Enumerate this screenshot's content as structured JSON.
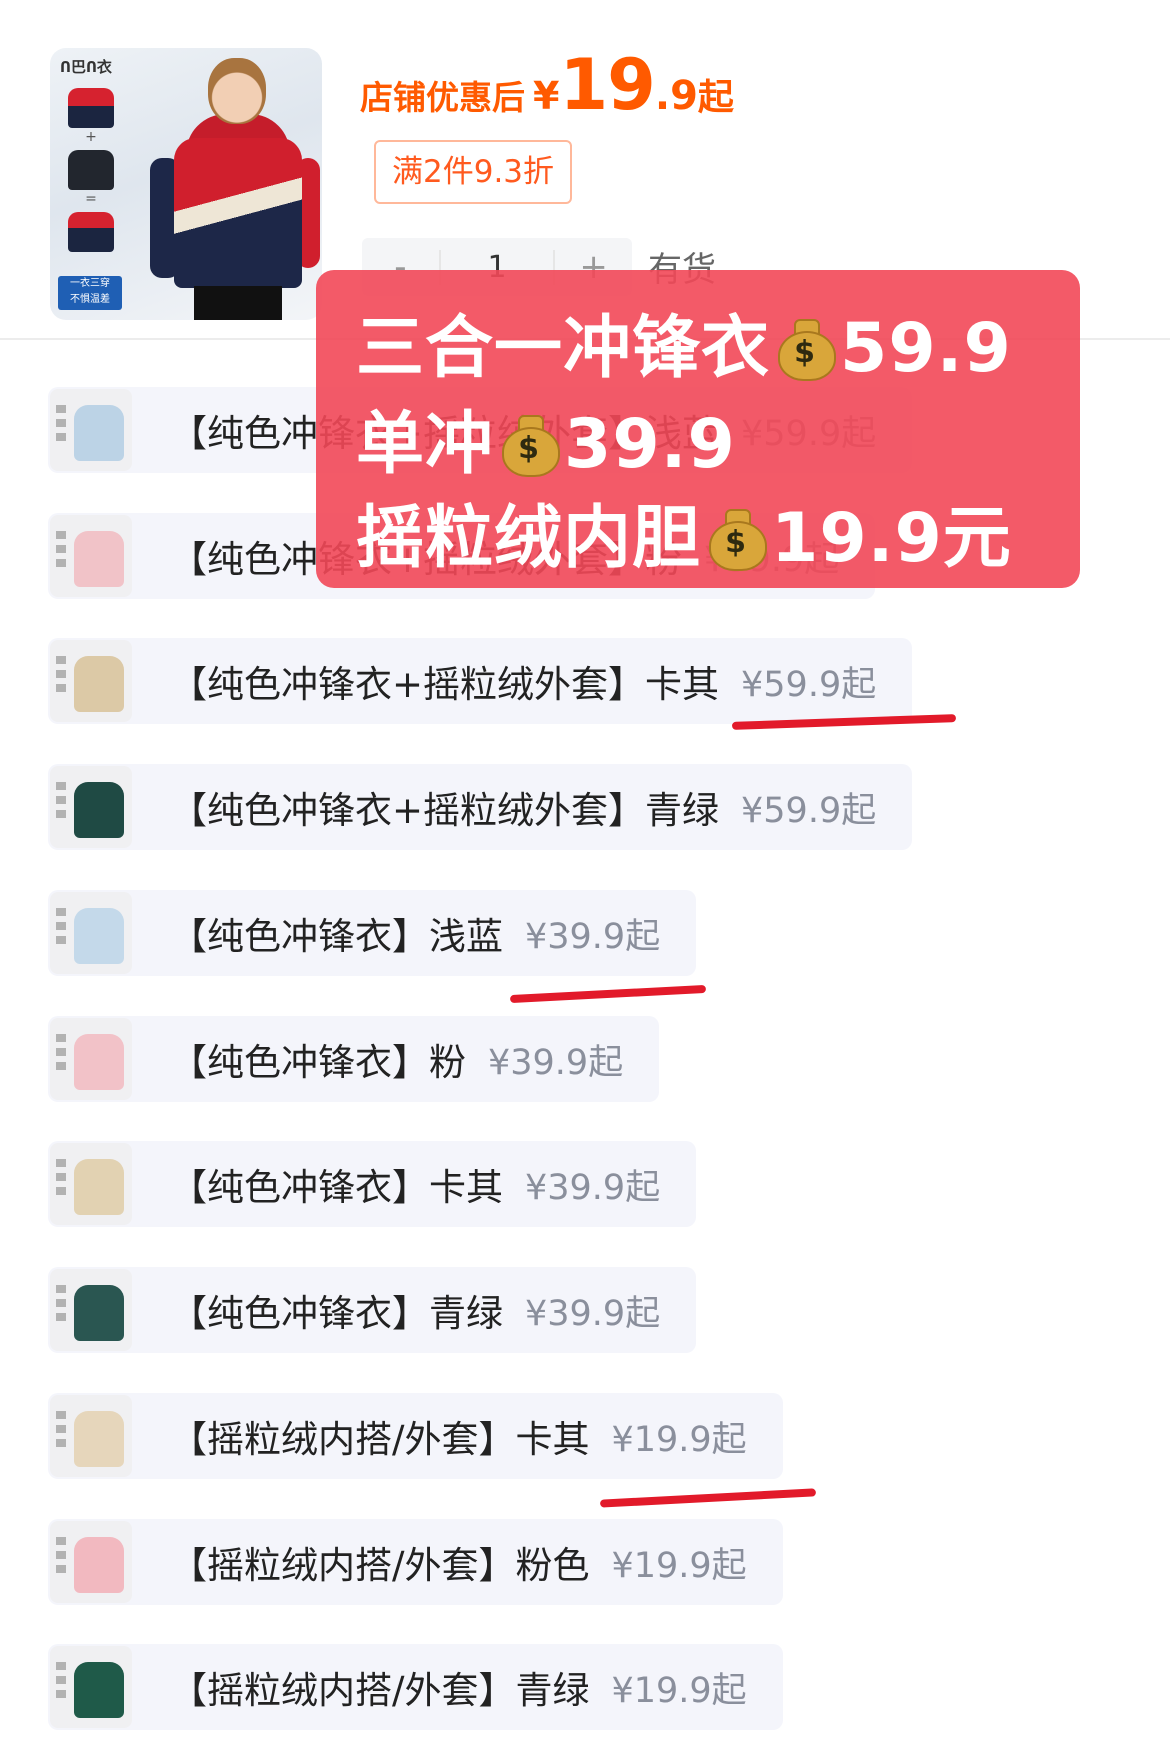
{
  "header": {
    "thumb_brand": "Ո巴Ո衣",
    "thumb_tag": "一衣三穿\n不惧温差",
    "price_label": "店铺优惠后",
    "price_currency": "¥",
    "price_int": "19",
    "price_dec": ".9",
    "price_suffix": "起",
    "promo_tag": "满2件9.3折",
    "stepper": {
      "minus": "-",
      "qty": "1",
      "plus": "+"
    },
    "stock": "有货"
  },
  "overlay": {
    "line1_text": "三合一冲锋衣",
    "line1_price": "59.9",
    "line2_text": "单冲",
    "line2_price": "39.9",
    "line3_text": "摇粒绒内胆",
    "line3_price": "19.9元",
    "moneybag_icon": "$"
  },
  "options": [
    {
      "label": "【纯色冲锋衣+摇粒绒外套】浅蓝",
      "price": "¥59.9起",
      "color": "#bcd3e6"
    },
    {
      "label": "【纯色冲锋衣+摇粒绒外套】粉",
      "price": "¥59.9起",
      "color": "#f1c3c8"
    },
    {
      "label": "【纯色冲锋衣+摇粒绒外套】卡其",
      "price": "¥59.9起",
      "color": "#dcc9a6"
    },
    {
      "label": "【纯色冲锋衣+摇粒绒外套】青绿",
      "price": "¥59.9起",
      "color": "#1f4a44"
    },
    {
      "label": "【纯色冲锋衣】浅蓝",
      "price": "¥39.9起",
      "color": "#c4d9ea"
    },
    {
      "label": "【纯色冲锋衣】粉",
      "price": "¥39.9起",
      "color": "#f2c2c8"
    },
    {
      "label": "【纯色冲锋衣】卡其",
      "price": "¥39.9起",
      "color": "#e2d2b2"
    },
    {
      "label": "【纯色冲锋衣】青绿",
      "price": "¥39.9起",
      "color": "#2a5651"
    },
    {
      "label": "【摇粒绒内搭/外套】卡其",
      "price": "¥19.9起",
      "color": "#e6d6bb"
    },
    {
      "label": "【摇粒绒内搭/外套】粉色",
      "price": "¥19.9起",
      "color": "#f2b9c0"
    },
    {
      "label": "【摇粒绒内搭/外套】青绿",
      "price": "¥19.9起",
      "color": "#1f5a49"
    }
  ],
  "colors": {
    "price_orange": "#ff5a00",
    "overlay_red": "#f24858",
    "underline_red": "#e21a2a"
  }
}
